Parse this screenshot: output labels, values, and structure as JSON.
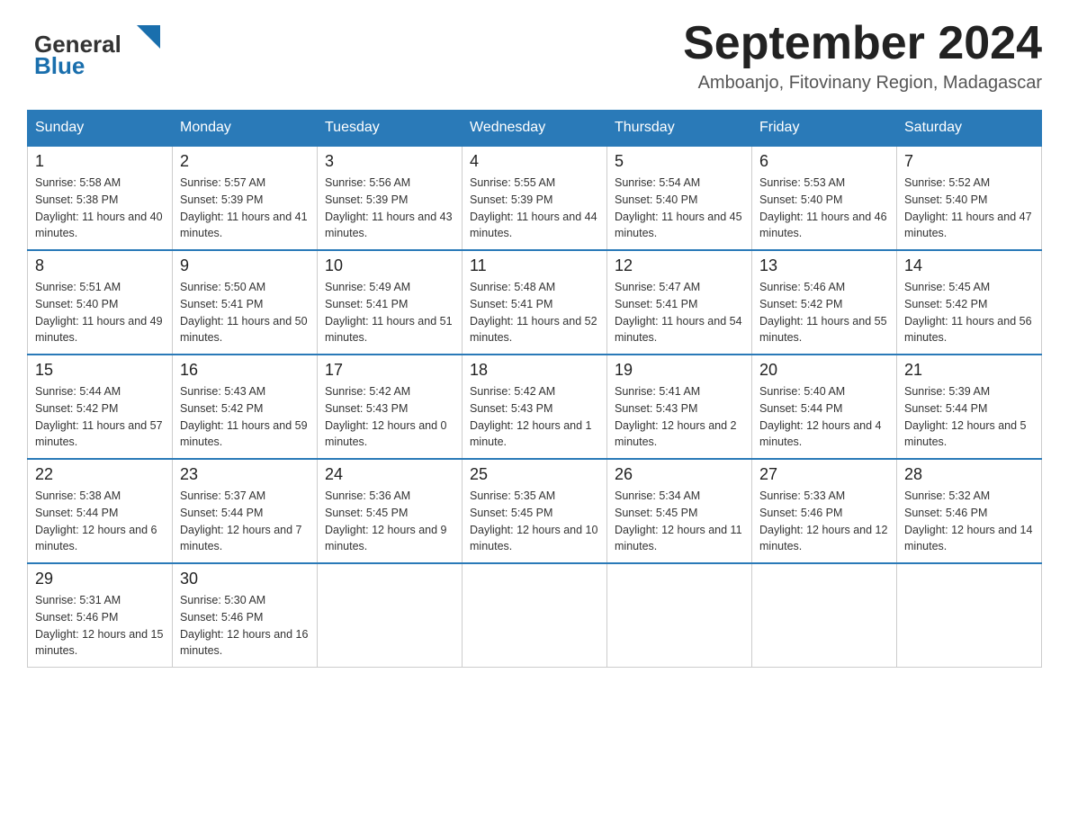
{
  "header": {
    "logo_general": "General",
    "logo_blue": "Blue",
    "month_title": "September 2024",
    "subtitle": "Amboanjo, Fitovinany Region, Madagascar"
  },
  "days_of_week": [
    "Sunday",
    "Monday",
    "Tuesday",
    "Wednesday",
    "Thursday",
    "Friday",
    "Saturday"
  ],
  "weeks": [
    [
      {
        "day": "1",
        "sunrise": "5:58 AM",
        "sunset": "5:38 PM",
        "daylight": "11 hours and 40 minutes."
      },
      {
        "day": "2",
        "sunrise": "5:57 AM",
        "sunset": "5:39 PM",
        "daylight": "11 hours and 41 minutes."
      },
      {
        "day": "3",
        "sunrise": "5:56 AM",
        "sunset": "5:39 PM",
        "daylight": "11 hours and 43 minutes."
      },
      {
        "day": "4",
        "sunrise": "5:55 AM",
        "sunset": "5:39 PM",
        "daylight": "11 hours and 44 minutes."
      },
      {
        "day": "5",
        "sunrise": "5:54 AM",
        "sunset": "5:40 PM",
        "daylight": "11 hours and 45 minutes."
      },
      {
        "day": "6",
        "sunrise": "5:53 AM",
        "sunset": "5:40 PM",
        "daylight": "11 hours and 46 minutes."
      },
      {
        "day": "7",
        "sunrise": "5:52 AM",
        "sunset": "5:40 PM",
        "daylight": "11 hours and 47 minutes."
      }
    ],
    [
      {
        "day": "8",
        "sunrise": "5:51 AM",
        "sunset": "5:40 PM",
        "daylight": "11 hours and 49 minutes."
      },
      {
        "day": "9",
        "sunrise": "5:50 AM",
        "sunset": "5:41 PM",
        "daylight": "11 hours and 50 minutes."
      },
      {
        "day": "10",
        "sunrise": "5:49 AM",
        "sunset": "5:41 PM",
        "daylight": "11 hours and 51 minutes."
      },
      {
        "day": "11",
        "sunrise": "5:48 AM",
        "sunset": "5:41 PM",
        "daylight": "11 hours and 52 minutes."
      },
      {
        "day": "12",
        "sunrise": "5:47 AM",
        "sunset": "5:41 PM",
        "daylight": "11 hours and 54 minutes."
      },
      {
        "day": "13",
        "sunrise": "5:46 AM",
        "sunset": "5:42 PM",
        "daylight": "11 hours and 55 minutes."
      },
      {
        "day": "14",
        "sunrise": "5:45 AM",
        "sunset": "5:42 PM",
        "daylight": "11 hours and 56 minutes."
      }
    ],
    [
      {
        "day": "15",
        "sunrise": "5:44 AM",
        "sunset": "5:42 PM",
        "daylight": "11 hours and 57 minutes."
      },
      {
        "day": "16",
        "sunrise": "5:43 AM",
        "sunset": "5:42 PM",
        "daylight": "11 hours and 59 minutes."
      },
      {
        "day": "17",
        "sunrise": "5:42 AM",
        "sunset": "5:43 PM",
        "daylight": "12 hours and 0 minutes."
      },
      {
        "day": "18",
        "sunrise": "5:42 AM",
        "sunset": "5:43 PM",
        "daylight": "12 hours and 1 minute."
      },
      {
        "day": "19",
        "sunrise": "5:41 AM",
        "sunset": "5:43 PM",
        "daylight": "12 hours and 2 minutes."
      },
      {
        "day": "20",
        "sunrise": "5:40 AM",
        "sunset": "5:44 PM",
        "daylight": "12 hours and 4 minutes."
      },
      {
        "day": "21",
        "sunrise": "5:39 AM",
        "sunset": "5:44 PM",
        "daylight": "12 hours and 5 minutes."
      }
    ],
    [
      {
        "day": "22",
        "sunrise": "5:38 AM",
        "sunset": "5:44 PM",
        "daylight": "12 hours and 6 minutes."
      },
      {
        "day": "23",
        "sunrise": "5:37 AM",
        "sunset": "5:44 PM",
        "daylight": "12 hours and 7 minutes."
      },
      {
        "day": "24",
        "sunrise": "5:36 AM",
        "sunset": "5:45 PM",
        "daylight": "12 hours and 9 minutes."
      },
      {
        "day": "25",
        "sunrise": "5:35 AM",
        "sunset": "5:45 PM",
        "daylight": "12 hours and 10 minutes."
      },
      {
        "day": "26",
        "sunrise": "5:34 AM",
        "sunset": "5:45 PM",
        "daylight": "12 hours and 11 minutes."
      },
      {
        "day": "27",
        "sunrise": "5:33 AM",
        "sunset": "5:46 PM",
        "daylight": "12 hours and 12 minutes."
      },
      {
        "day": "28",
        "sunrise": "5:32 AM",
        "sunset": "5:46 PM",
        "daylight": "12 hours and 14 minutes."
      }
    ],
    [
      {
        "day": "29",
        "sunrise": "5:31 AM",
        "sunset": "5:46 PM",
        "daylight": "12 hours and 15 minutes."
      },
      {
        "day": "30",
        "sunrise": "5:30 AM",
        "sunset": "5:46 PM",
        "daylight": "12 hours and 16 minutes."
      },
      null,
      null,
      null,
      null,
      null
    ]
  ]
}
